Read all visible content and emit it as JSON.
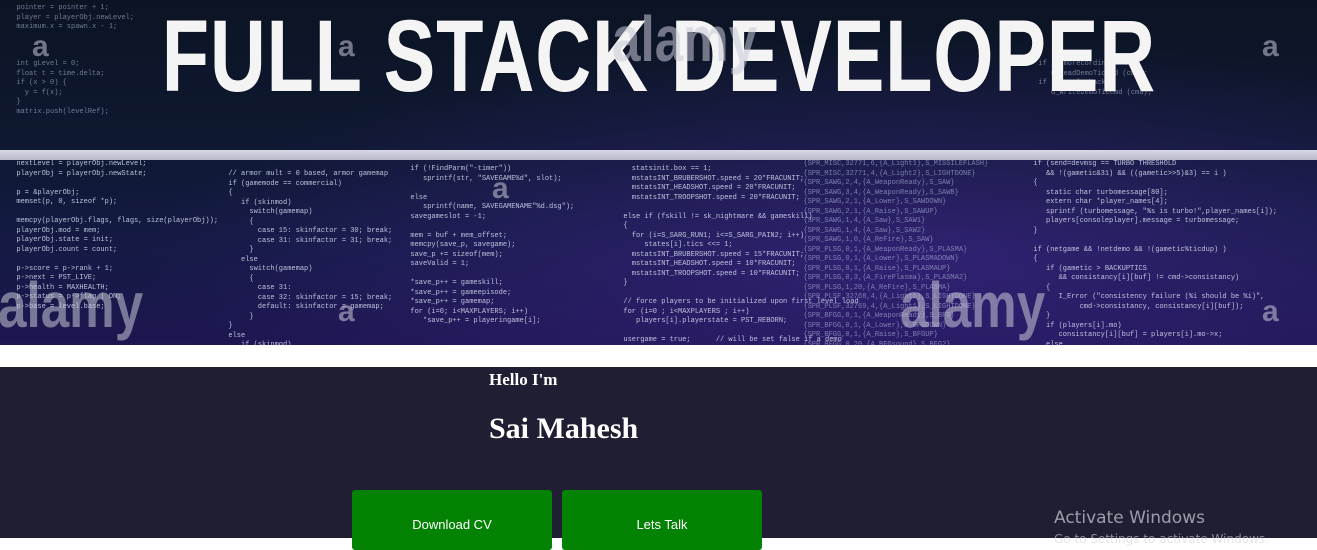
{
  "banner": {
    "headline": "FULL STACK DEVELOPER",
    "watermark_text": "alamy",
    "watermark_letter": "a"
  },
  "intro": {
    "greeting": "Hello I'm",
    "name": "Sai Mahesh"
  },
  "buttons": {
    "download_cv": "Download CV",
    "lets_talk": "Lets Talk"
  },
  "colors": {
    "banner_bg": "#101a3a",
    "section_bg": "#1f1e33",
    "button_green": "#048203",
    "text_white": "#ffffff"
  },
  "os_overlay": {
    "activate_title": "Activate Windows",
    "activate_sub": "Go to Settings to activate Windows."
  }
}
